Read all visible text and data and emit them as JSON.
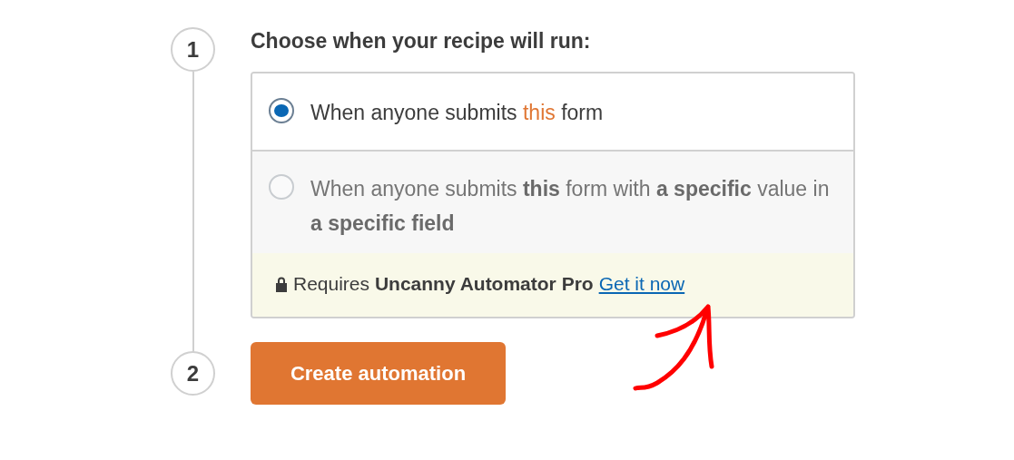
{
  "steps": [
    {
      "number": "1"
    },
    {
      "number": "2"
    }
  ],
  "heading": "Choose when your recipe will run:",
  "options": [
    {
      "text": "When anyone submits **this** form",
      "selected": true,
      "disabled": false
    },
    {
      "text": "When anyone submits **this** form with **a specific** value in **a specific field**",
      "selected": false,
      "disabled": true
    }
  ],
  "notice": {
    "text": "Requires **Uncanny Automator Pro**",
    "link": "Get it now"
  },
  "button": "Create automation"
}
